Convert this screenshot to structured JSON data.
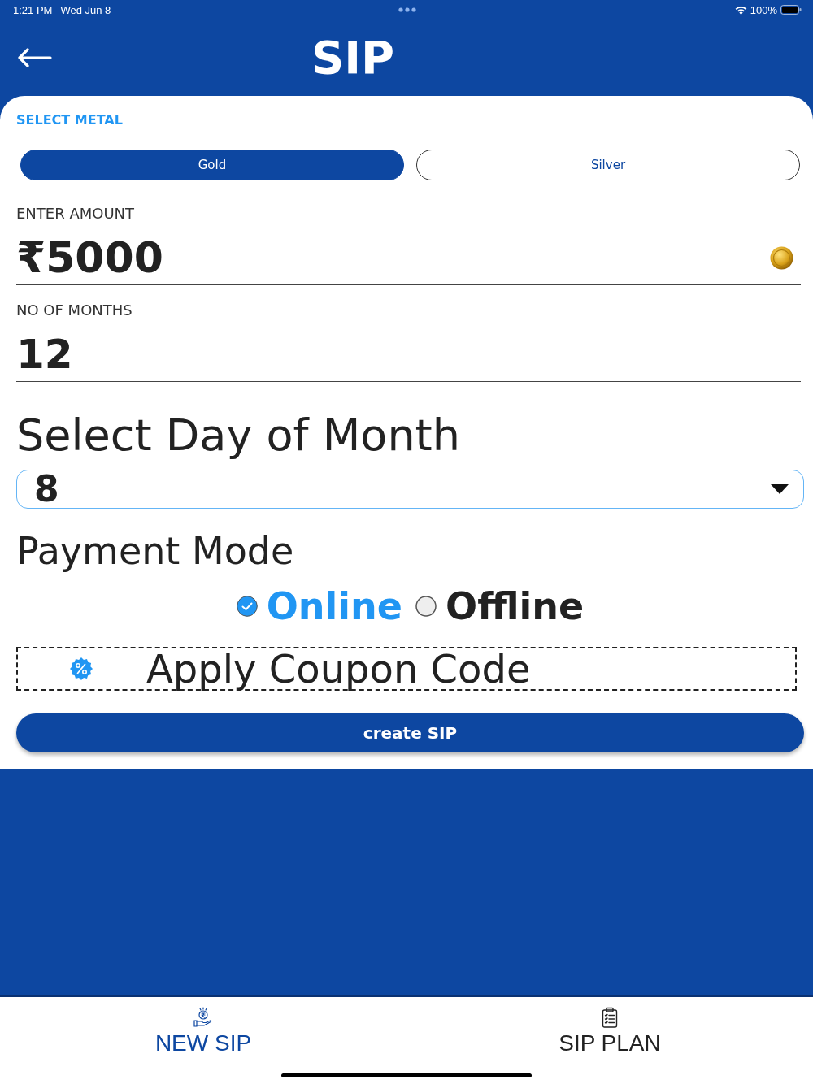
{
  "status_bar": {
    "time": "1:21 PM",
    "date": "Wed Jun 8",
    "battery": "100%"
  },
  "header": {
    "title": "SIP"
  },
  "metal": {
    "label": "SELECT METAL",
    "options": [
      {
        "label": "Gold",
        "selected": true
      },
      {
        "label": "Silver",
        "selected": false
      }
    ]
  },
  "amount": {
    "label": "ENTER AMOUNT",
    "value": "₹5000"
  },
  "months": {
    "label": "NO OF MONTHS",
    "value": "12"
  },
  "day": {
    "label": "Select Day of Month",
    "value": "8"
  },
  "payment": {
    "label": "Payment Mode",
    "options": [
      {
        "label": "Online",
        "selected": true
      },
      {
        "label": "Offline",
        "selected": false
      }
    ]
  },
  "coupon": {
    "label": "Apply Coupon Code"
  },
  "submit": {
    "label": "create SIP"
  },
  "tabs": [
    {
      "kind": "new",
      "label": "NEW SIP",
      "selected": true
    },
    {
      "kind": "plan",
      "label": "SIP PLAN",
      "selected": false
    }
  ]
}
